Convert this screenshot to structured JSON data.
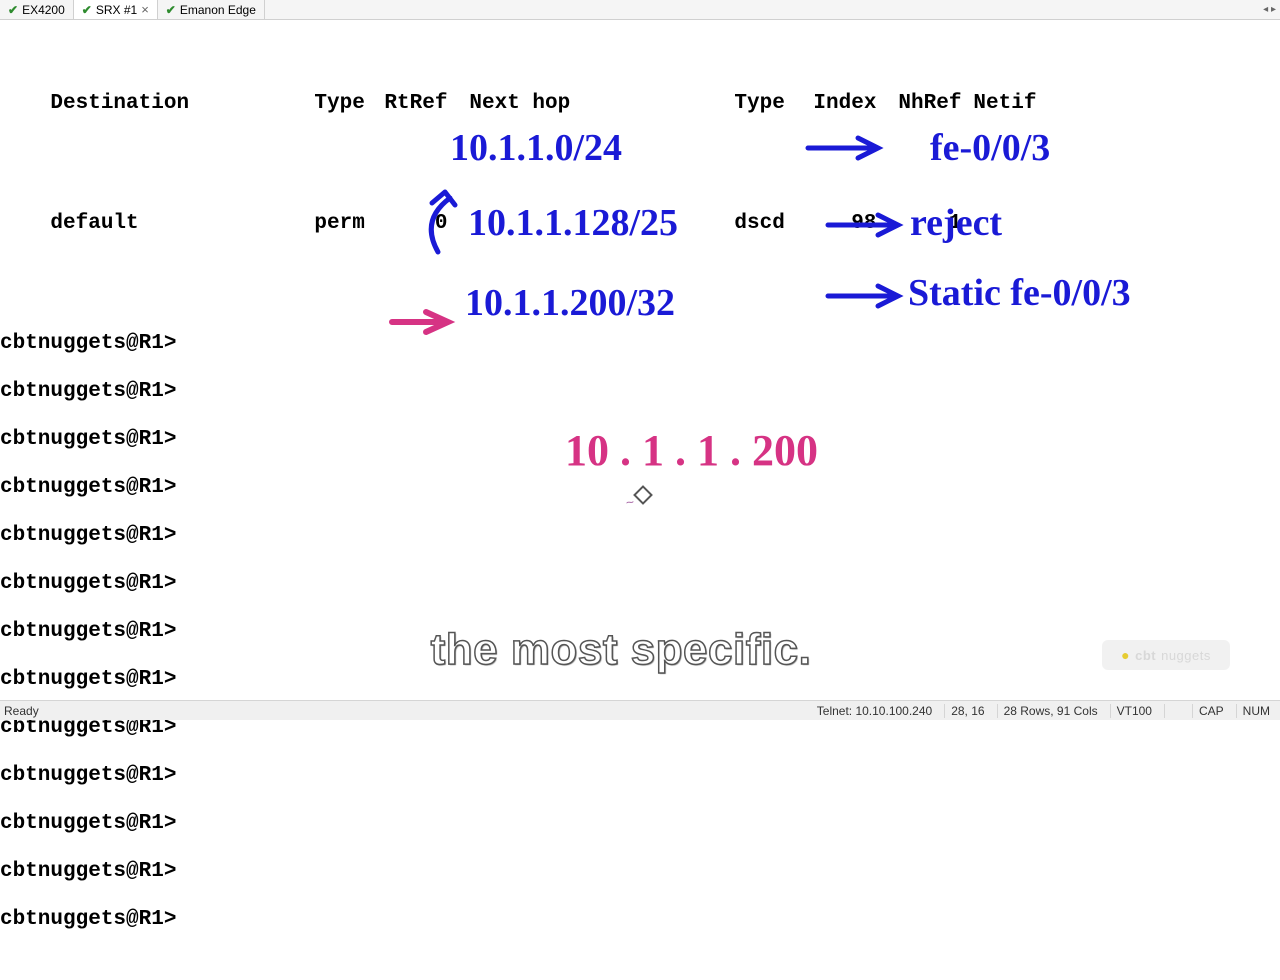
{
  "tabs": [
    {
      "label": "EX4200",
      "active": false,
      "closeable": false
    },
    {
      "label": "SRX #1",
      "active": true,
      "closeable": true
    },
    {
      "label": "Emanon Edge",
      "active": false,
      "closeable": false
    }
  ],
  "terminal": {
    "headers": {
      "destination": "Destination",
      "type1": "Type",
      "rtref": "RtRef",
      "nexthop": "Next hop",
      "type2": "Type",
      "index": "Index",
      "nhref": "NhRef",
      "netif": "Netif"
    },
    "row": {
      "destination": "default",
      "type1": "perm",
      "rtref": "    0",
      "nexthop": "",
      "type2": "dscd",
      "index": "98",
      "nhref": "1",
      "netif": ""
    },
    "prompt": "cbtnuggets@R1>",
    "prompt_count": 13
  },
  "annotations": {
    "line1": {
      "text": "10.1.1.0/24",
      "action": "fe-0/0/3"
    },
    "line2": {
      "text": "10.1.1.128/25",
      "action": "reject"
    },
    "line3": {
      "text": "10.1.1.200/32",
      "action": "Static  fe-0/0/3"
    },
    "target": "10 . 1 . 1 . 200"
  },
  "subtitle": "the most specific.",
  "watermark": {
    "brand": "cbt",
    "name": "nuggets"
  },
  "status": {
    "ready": "Ready",
    "conn": "Telnet: 10.10.100.240",
    "cursor": "28, 16",
    "size": "28 Rows, 91 Cols",
    "emul": "VT100",
    "cap": "CAP",
    "num": "NUM"
  }
}
